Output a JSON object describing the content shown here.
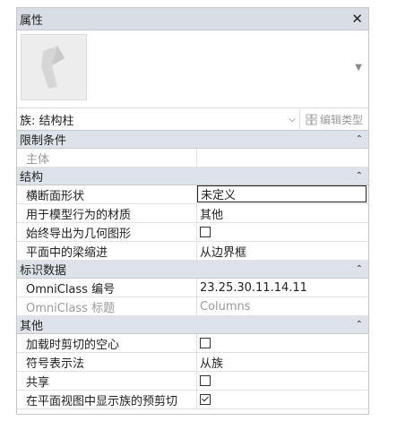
{
  "panel": {
    "title": "属性",
    "close": "✕"
  },
  "preview": {
    "dropdown_glyph": "▼"
  },
  "type_selector": {
    "label": "族: 结构柱",
    "chevron": "⌵",
    "edit_type_label": "编辑类型"
  },
  "sections": [
    {
      "title": "限制条件",
      "collapse_glyph": "⌃",
      "rows": [
        {
          "key": "主体",
          "value": "",
          "dim": true
        }
      ]
    },
    {
      "title": "结构",
      "collapse_glyph": "⌃",
      "rows": [
        {
          "key": "横断面形状",
          "value": "未定义",
          "active": true
        },
        {
          "key": "用于模型行为的材质",
          "value": "其他"
        },
        {
          "key": "始终导出为几何图形",
          "checkbox": true,
          "checked": false
        },
        {
          "key": "平面中的梁缩进",
          "value": "从边界框"
        }
      ]
    },
    {
      "title": "标识数据",
      "collapse_glyph": "⌃",
      "rows": [
        {
          "key": "OmniClass 编号",
          "value": "23.25.30.11.14.11"
        },
        {
          "key": "OmniClass 标题",
          "value": "Columns",
          "dim": true
        }
      ]
    },
    {
      "title": "其他",
      "collapse_glyph": "⌃",
      "rows": [
        {
          "key": "加载时剪切的空心",
          "checkbox": true,
          "checked": false
        },
        {
          "key": "符号表示法",
          "value": "从族"
        },
        {
          "key": "共享",
          "checkbox": true,
          "checked": false
        },
        {
          "key": "在平面视图中显示族的预剪切",
          "checkbox": true,
          "checked": true
        }
      ]
    }
  ]
}
